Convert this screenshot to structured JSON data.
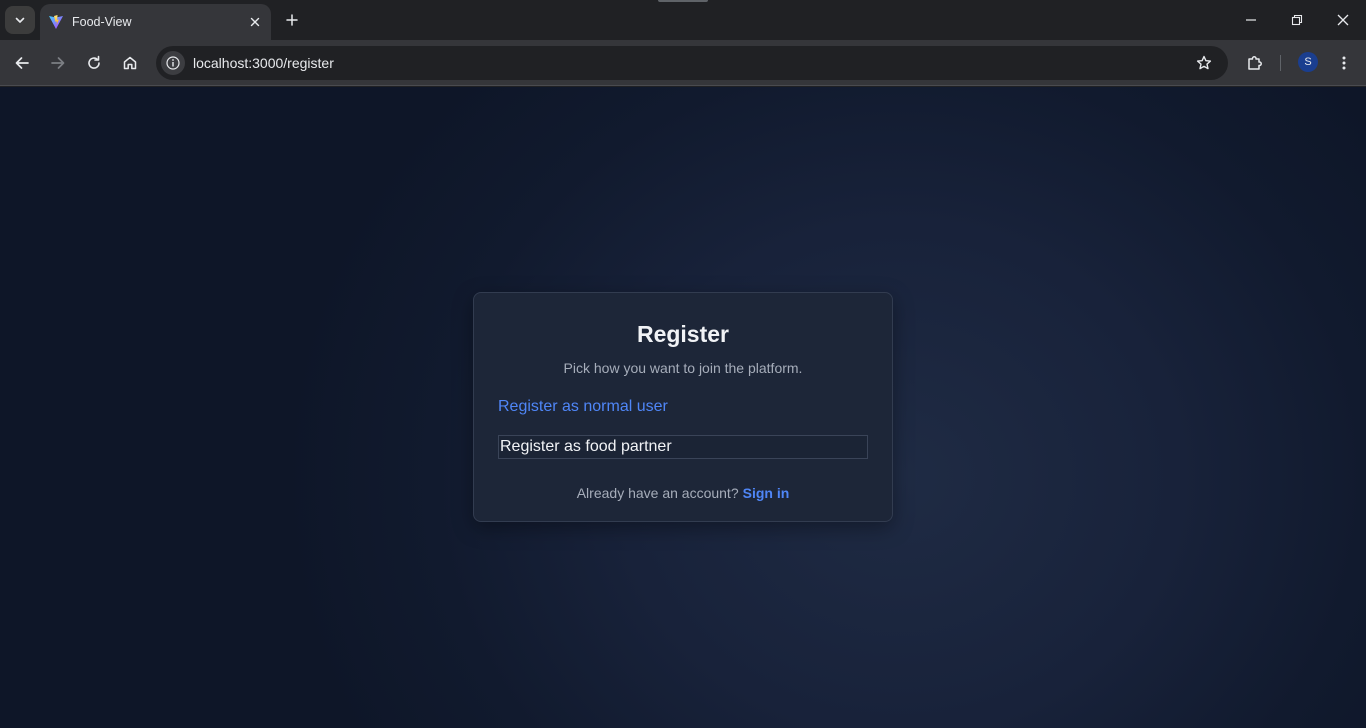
{
  "browser": {
    "tab": {
      "title": "Food-View",
      "favicon": "vite-logo-icon"
    },
    "url": "localhost:3000/register",
    "profile_initial": "S"
  },
  "page": {
    "title": "Register",
    "subtitle": "Pick how you want to join the platform.",
    "normal_user_label": "Register as normal user",
    "food_partner_label": "Register as food partner",
    "footer_text": "Already have an account?",
    "signin_label": "Sign in"
  },
  "colors": {
    "accent": "#4f86f7",
    "card_bg": "#1d2638",
    "page_bg": "#111a2e"
  }
}
